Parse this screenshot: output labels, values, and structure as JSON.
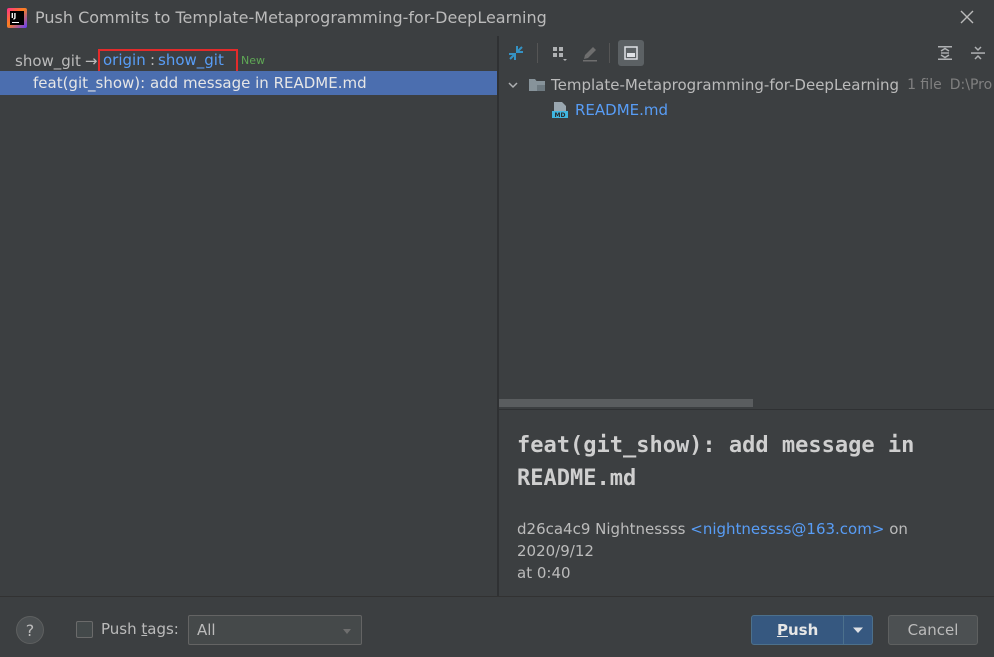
{
  "window": {
    "title": "Push Commits to Template-Metaprogramming-for-DeepLearning",
    "icon": "intellij-app-icon",
    "icon_text": "IJ"
  },
  "left": {
    "local_branch": "show_git",
    "arrow": "→",
    "remote": "origin",
    "separator": ":",
    "remote_branch": "show_git",
    "new_badge": "New",
    "commits": [
      {
        "message": "feat(git_show): add message in README.md"
      }
    ]
  },
  "toolbar": {
    "buttons": [
      "compare-icon",
      "group-by-icon",
      "edit-source-icon",
      "show-details-icon",
      "expand-all-icon",
      "collapse-all-icon"
    ]
  },
  "tree": {
    "root_label": "Template-Metaprogramming-for-DeepLearning",
    "root_meta": "1 file",
    "root_path": "D:\\Pro",
    "files": [
      {
        "name": "README.md",
        "icon": "markdown-file-icon",
        "icon_text": "MD"
      }
    ]
  },
  "details": {
    "title": "feat(git_show): add message in README.md",
    "hash": "d26ca4c9",
    "author": "Nightnessss",
    "email": "<nightnessss@163.com>",
    "date_prefix": "on 2020/9/12",
    "date_suffix": "at 0:40"
  },
  "footer": {
    "help_label": "?",
    "push_tags_label_pre": "Push ",
    "push_tags_label_u": "t",
    "push_tags_label_post": "ags:",
    "push_tags_checked": false,
    "tags_select_value": "All",
    "push_label_u": "P",
    "push_label_rest": "ush",
    "cancel_label": "Cancel"
  },
  "colors": {
    "background": "#3c3f41",
    "selection": "#4b6eaf",
    "link": "#589df6",
    "new_badge": "#5fa855",
    "highlight_box": "#e32b2b",
    "push_button": "#365880"
  }
}
